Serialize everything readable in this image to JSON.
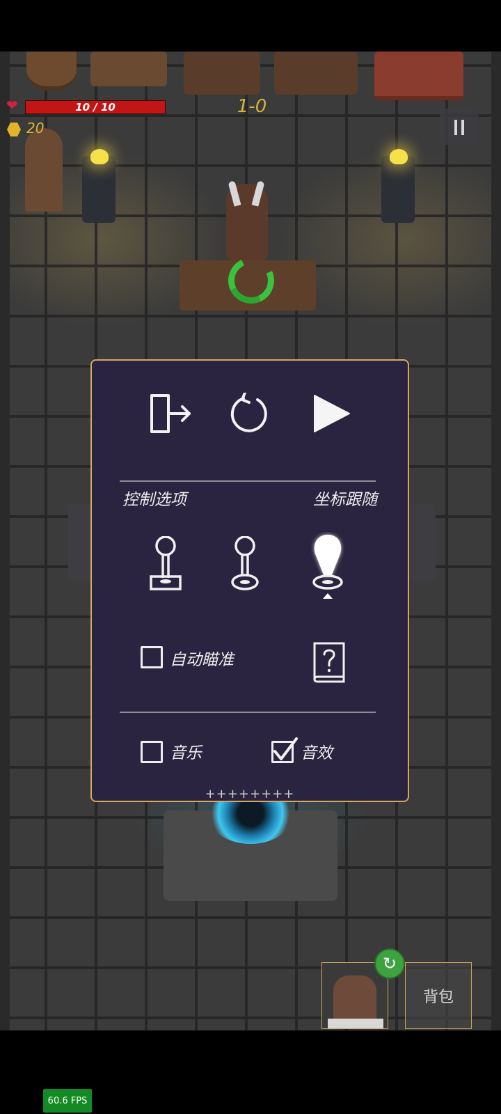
{
  "hud": {
    "hp_text": "10 / 10",
    "coins": "20",
    "level": "1-0"
  },
  "settings_panel": {
    "control_options_label": "控制选项",
    "control_mode_label": "坐标跟随",
    "auto_aim_label": "自动瞄准",
    "auto_aim_checked": false,
    "music_label": "音乐",
    "music_checked": false,
    "sfx_label": "音效",
    "sfx_checked": true,
    "selected_control_mode": "floating-joystick",
    "footer_text": "++++++++"
  },
  "bottom_bar": {
    "bag_label": "背包"
  },
  "fps": "60.6 FPS",
  "colors": {
    "panel_bg": "#2b2440",
    "panel_border": "#d6a85a",
    "hp_bar": "#c41515",
    "coin": "#e3b32a",
    "level_text": "#d8b23a",
    "fps_bg": "#138a23"
  }
}
